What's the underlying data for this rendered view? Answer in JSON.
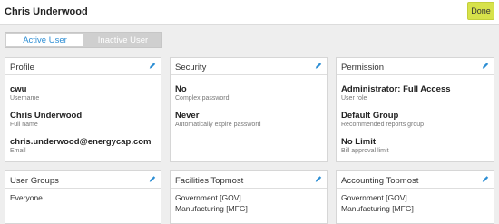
{
  "header": {
    "title": "Chris Underwood",
    "done_label": "Done"
  },
  "toggle": {
    "active_label": "Active User",
    "inactive_label": "Inactive User"
  },
  "profile": {
    "title": "Profile",
    "username_value": "cwu",
    "username_label": "Username",
    "fullname_value": "Chris Underwood",
    "fullname_label": "Full name",
    "email_value": "chris.underwood@energycap.com",
    "email_label": "Email"
  },
  "security": {
    "title": "Security",
    "complex_value": "No",
    "complex_label": "Complex password",
    "expire_value": "Never",
    "expire_label": "Automatically expire password"
  },
  "permission": {
    "title": "Permission",
    "role_value": "Administrator: Full Access",
    "role_label": "User role",
    "reports_value": "Default Group",
    "reports_label": "Recommended reports group",
    "limit_value": "No Limit",
    "limit_label": "Bill approval limit"
  },
  "user_groups": {
    "title": "User Groups",
    "items": [
      "Everyone"
    ]
  },
  "facilities": {
    "title": "Facilities Topmost",
    "items": [
      "Government [GOV]",
      "Manufacturing [MFG]"
    ]
  },
  "accounting": {
    "title": "Accounting Topmost",
    "items": [
      "Government [GOV]",
      "Manufacturing [MFG]"
    ]
  },
  "colors": {
    "accent": "#2d8ed4",
    "done_button": "#d7e24a",
    "background": "#eeeeee"
  },
  "icons": {
    "edit": "pencil-icon"
  }
}
